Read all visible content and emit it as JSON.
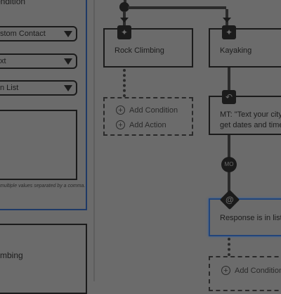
{
  "settings": {
    "condition_label": "ondition",
    "contact_select": "stom Contact",
    "text_select": "xt",
    "list_select": "n List",
    "hint": "multiple values separated by a comma."
  },
  "lower_panel": {
    "label": "mbing"
  },
  "flow": {
    "mo_badge": "MO",
    "nodes": {
      "rock_climbing": {
        "label": "Rock Climbing"
      },
      "kayaking": {
        "label": "Kayaking"
      },
      "message": {
        "line1": "MT: \"Text your city to",
        "line2": "get dates and times."
      },
      "response": {
        "label": "Response is in list."
      }
    },
    "add_condition": "Add Condition",
    "add_action": "Add Action",
    "icons": {
      "action": "wand-icon",
      "reply": "reply-icon",
      "at": "at-icon"
    }
  }
}
